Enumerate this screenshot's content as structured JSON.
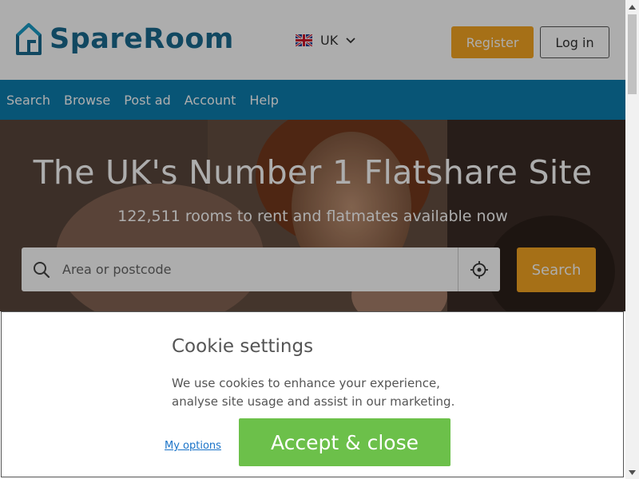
{
  "header": {
    "logo_text": "SpareRoom",
    "country": "UK",
    "register_label": "Register",
    "login_label": "Log in"
  },
  "nav": {
    "items": [
      "Search",
      "Browse",
      "Post ad",
      "Account",
      "Help"
    ]
  },
  "hero": {
    "title": "The UK's Number 1 Flatshare Site",
    "subtitle": "122,511 rooms to rent and flatmates available now",
    "search_placeholder": "Area or postcode",
    "search_button": "Search"
  },
  "cookie": {
    "title": "Cookie settings",
    "body": "We use cookies to enhance your experience, analyse site usage and assist in our marketing.",
    "options_link": "My options",
    "accept_button": "Accept & close"
  },
  "colors": {
    "brand_blue": "#1a6b8f",
    "nav_blue": "#0d7eaf",
    "orange": "#f5a623",
    "green": "#6cc04a"
  },
  "icons": [
    "house-logo-icon",
    "uk-flag-icon",
    "chevron-down-icon",
    "search-icon",
    "locate-icon",
    "scroll-up-icon",
    "scroll-down-icon"
  ]
}
